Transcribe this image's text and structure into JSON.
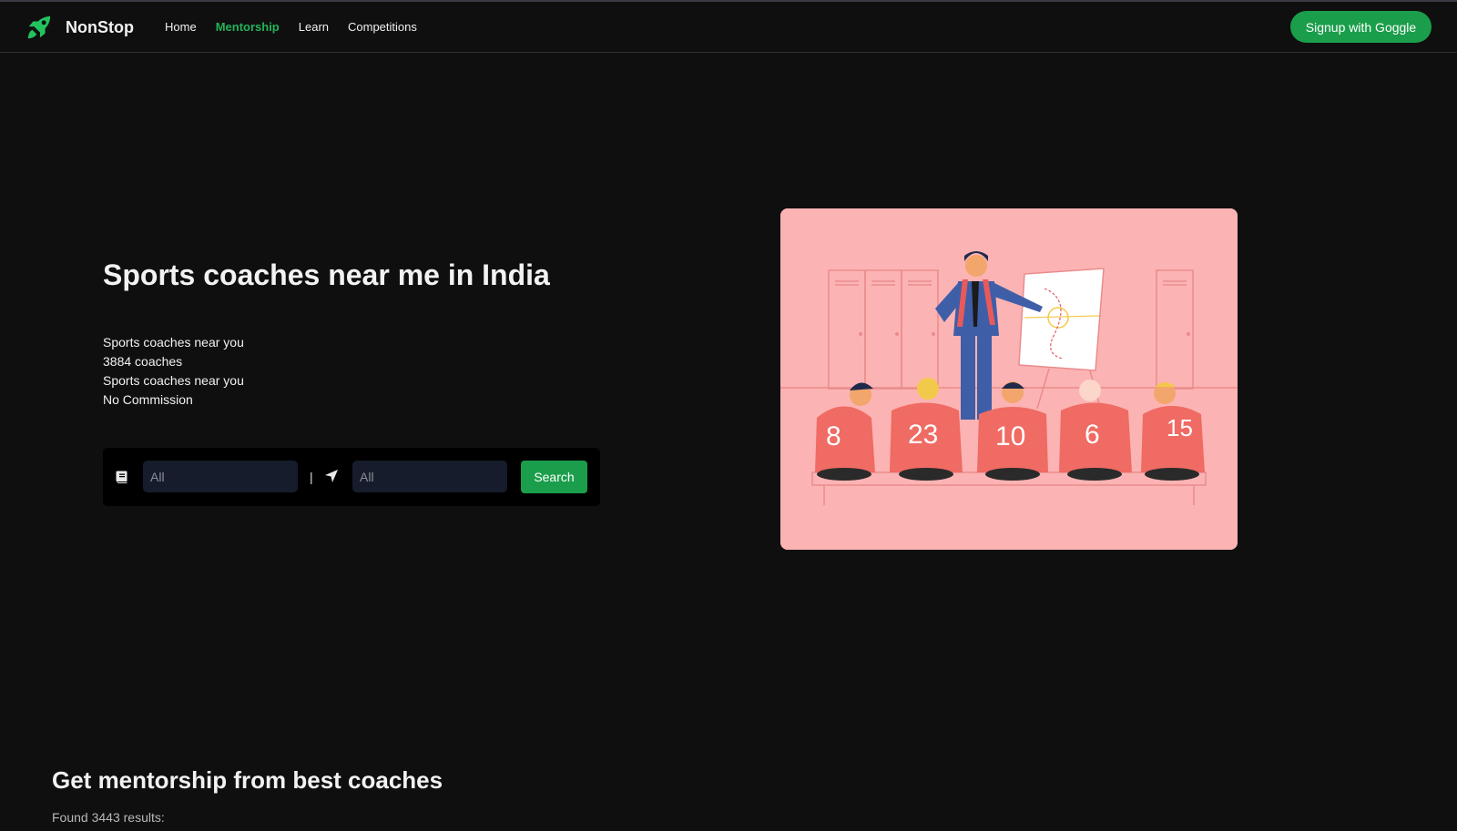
{
  "app": {
    "name": "NonStop",
    "logo_icon": "rocket-icon",
    "accent": "#1b9e4b"
  },
  "nav": {
    "links": [
      {
        "label": "Home",
        "active": false
      },
      {
        "label": "Mentorship",
        "active": true
      },
      {
        "label": "Learn",
        "active": false
      },
      {
        "label": "Competitions",
        "active": false
      }
    ],
    "signup_label": "Signup with Goggle"
  },
  "hero": {
    "title": "Sports coaches near me in India",
    "facts": [
      "Sports coaches near you",
      "3884 coaches",
      "Sports coaches near you",
      "No Commission"
    ],
    "illustration": {
      "icon": "coach-team-illustration",
      "background": "#fcb3b3",
      "jersey_numbers": [
        "8",
        "23",
        "10",
        "6",
        "15"
      ]
    }
  },
  "search": {
    "category_icon": "book-icon",
    "category_placeholder": "All",
    "separator": "|",
    "location_icon": "location-arrow-icon",
    "location_placeholder": "All",
    "button_label": "Search"
  },
  "results": {
    "title": "Get mentorship from best coaches",
    "count_text": "Found 3443 results:"
  }
}
